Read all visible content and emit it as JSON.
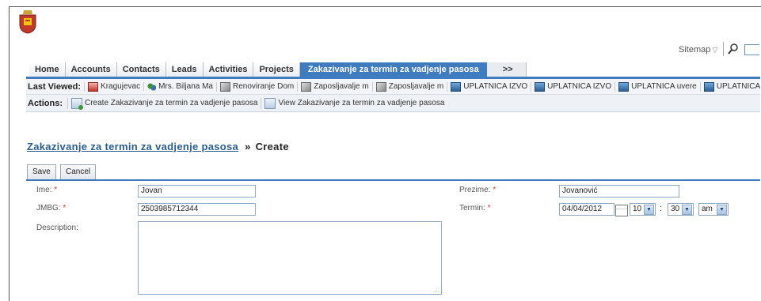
{
  "header": {
    "sitemap_label": "Sitemap"
  },
  "tabs": [
    "Home",
    "Accounts",
    "Contacts",
    "Leads",
    "Activities",
    "Projects"
  ],
  "active_tab": "Zakazivanje za termin za vadjenje pasosa",
  "more_tab": ">>",
  "last_viewed": {
    "label": "Last Viewed:",
    "items": [
      {
        "label": "Kragujevac",
        "icon": "account-icon"
      },
      {
        "label": "Mrs. Biljana Ma",
        "icon": "contact-icon"
      },
      {
        "label": "Renoviranje Dom",
        "icon": "project-icon"
      },
      {
        "label": "Zaposljavalje m",
        "icon": "project-icon"
      },
      {
        "label": "Zaposljavalje m",
        "icon": "project-icon"
      },
      {
        "label": "UPLATNICA IZVO",
        "icon": "document-icon"
      },
      {
        "label": "UPLATNICA IZVO",
        "icon": "document-icon"
      },
      {
        "label": "UPLATNICA uvere",
        "icon": "document-icon"
      },
      {
        "label": "UPLATNICA inter",
        "icon": "document-icon"
      }
    ]
  },
  "actions": {
    "label": "Actions:",
    "create_label": "Create Zakazivanje za termin za vadjenje pasosa",
    "view_label": "View Zakazivanje za termin za vadjenje pasosa"
  },
  "page": {
    "module_link": "Zakazivanje za termin za vadjenje pasosa",
    "separator": "»",
    "action": "Create"
  },
  "buttons": {
    "save": "Save",
    "cancel": "Cancel"
  },
  "form": {
    "ime_label": "Ime:",
    "ime_value": "Jovan",
    "prezime_label": "Prezime:",
    "prezime_value": "Jovanović",
    "jmbg_label": "JMBG:",
    "jmbg_value": "2503985712344",
    "termin_label": "Termin:",
    "termin_date": "04/04/2012",
    "termin_hour": "10",
    "termin_minute": "30",
    "termin_ampm": "am",
    "description_label": "Description:",
    "required_marker": "*",
    "time_separator": ":"
  },
  "colors": {
    "accent": "#3f7cbf",
    "link": "#2a5d8f",
    "required": "#dd3333"
  }
}
